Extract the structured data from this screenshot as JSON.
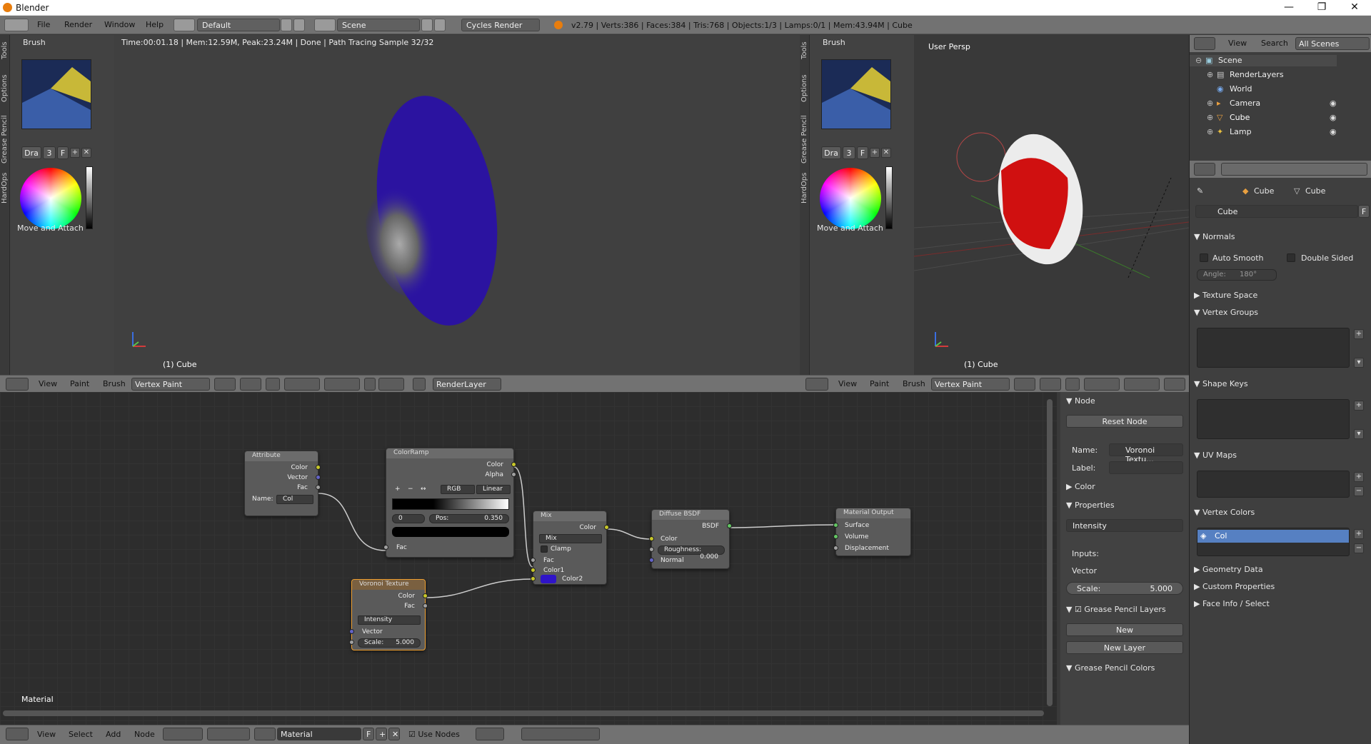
{
  "window": {
    "title": "Blender",
    "min": "—",
    "max": "❐",
    "close": "✕"
  },
  "topbar": {
    "menus": [
      "File",
      "Render",
      "Window",
      "Help"
    ],
    "layout": "Default",
    "scene": "Scene",
    "engine": "Cycles Render",
    "stats": "v2.79 | Verts:386 | Faces:384 | Tris:768 | Objects:1/3 | Lamps:0/1 | Mem:43.94M | Cube"
  },
  "left_tools": {
    "tabs": [
      "Tools",
      "Options",
      "Grease Pencil",
      "HardOps"
    ],
    "brush_header": "Brush",
    "brush_buttons": [
      "Dra",
      "3",
      "F"
    ],
    "move_attach": "Move and Attach"
  },
  "viewport_left": {
    "status": "Time:00:01.18 | Mem:12.59M, Peak:23.24M | Done | Path Tracing Sample 32/32",
    "object_label": "(1) Cube",
    "header": {
      "menus": [
        "View",
        "Paint",
        "Brush"
      ],
      "mode": "Vertex Paint",
      "render_layer": "RenderLayer"
    }
  },
  "viewport_right": {
    "title": "User Persp",
    "object_label": "(1) Cube",
    "header": {
      "menus": [
        "View",
        "Paint",
        "Brush"
      ],
      "mode": "Vertex Paint"
    }
  },
  "outliner": {
    "header": {
      "view": "View",
      "search": "Search",
      "filter": "All Scenes"
    },
    "items": [
      {
        "label": "Scene"
      },
      {
        "label": "RenderLayers"
      },
      {
        "label": "World"
      },
      {
        "label": "Camera"
      },
      {
        "label": "Cube"
      },
      {
        "label": "Lamp"
      }
    ]
  },
  "properties": {
    "breadcrumb": [
      "Cube",
      "Cube"
    ],
    "mesh_name": "Cube",
    "fake_user": "F",
    "sections": {
      "normals": "Normals",
      "auto_smooth": "Auto Smooth",
      "double_sided": "Double Sided",
      "angle": "Angle:",
      "angle_value": "180°",
      "texture_space": "Texture Space",
      "vertex_groups": "Vertex Groups",
      "shape_keys": "Shape Keys",
      "uv_maps": "UV Maps",
      "vertex_colors": "Vertex Colors",
      "vertex_color_item": "Col",
      "geometry_data": "Geometry Data",
      "custom_properties": "Custom Properties",
      "face_info": "Face Info / Select"
    }
  },
  "node_sidebar": {
    "node_header": "Node",
    "reset": "Reset Node",
    "name_label": "Name:",
    "name_value": "Voronoi Textu...",
    "label_label": "Label:",
    "color": "Color",
    "properties": "Properties",
    "coloring": "Intensity",
    "inputs": "Inputs:",
    "vector": "Vector",
    "scale_label": "Scale:",
    "scale_value": "5.000",
    "gp_layers": "Grease Pencil Layers",
    "new": "New",
    "new_layer": "New Layer",
    "gp_colors": "Grease Pencil Colors"
  },
  "nodes": {
    "attribute": {
      "title": "Attribute",
      "color": "Color",
      "vector": "Vector",
      "fac": "Fac",
      "name_label": "Name:",
      "name_value": "Col"
    },
    "colorramp": {
      "title": "ColorRamp",
      "color": "Color",
      "alpha": "Alpha",
      "mode": "RGB",
      "interp": "Linear",
      "index": "0",
      "pos_label": "Pos:",
      "pos_value": "0.350",
      "fac": "Fac"
    },
    "mix": {
      "title": "Mix",
      "color": "Color",
      "blend": "Mix",
      "clamp": "Clamp",
      "fac": "Fac",
      "color1": "Color1",
      "color2": "Color2"
    },
    "diffuse": {
      "title": "Diffuse BSDF",
      "bsdf": "BSDF",
      "color": "Color",
      "roughness_label": "Roughness:",
      "roughness_value": "0.000",
      "normal": "Normal"
    },
    "output": {
      "title": "Material Output",
      "surface": "Surface",
      "volume": "Volume",
      "displacement": "Displacement"
    },
    "voronoi": {
      "title": "Voronoi Texture",
      "color": "Color",
      "fac": "Fac",
      "coloring": "Intensity",
      "vector": "Vector",
      "scale_label": "Scale:",
      "scale_value": "5.000"
    }
  },
  "node_editor": {
    "material_label": "Material",
    "header": {
      "menus": [
        "View",
        "Select",
        "Add",
        "Node"
      ],
      "material": "Material",
      "fake": "F",
      "use_nodes": "Use Nodes"
    }
  },
  "colors": {
    "accent_blue": "#5680c2",
    "node_selected": "#f0a030",
    "socket_yellow": "#c7c729",
    "socket_blue": "#6363c7",
    "socket_green": "#63c763",
    "mix_color2": "#2f14c8"
  }
}
